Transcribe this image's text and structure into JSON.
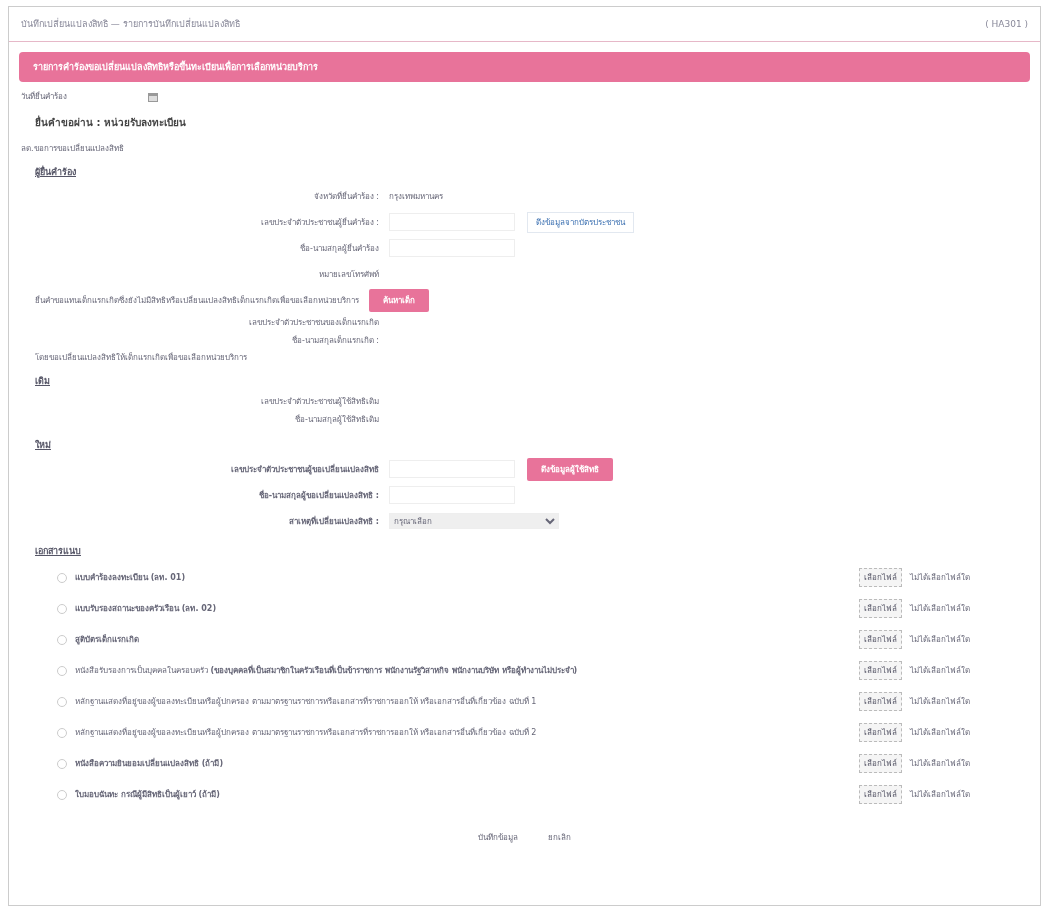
{
  "header": {
    "title": "บันทึกเปลี่ยนแปลงสิทธิ — รายการบันทึกเปลี่ยนแปลงสิทธิ",
    "code": "( HA301 )"
  },
  "banner": "รายการคำร้องขอเปลี่ยนแปลงสิทธิหรือขึ้นทะเบียนเพื่อการเลือกหน่วยบริการ",
  "submit_date": {
    "label": "วันที่ยื่นคำร้อง"
  },
  "channel": "ยื่นคำขอผ่าน : หน่วยรับลงทะเบียน",
  "subtitle": "ลด.ขอการขอเปลี่ยนแปลงสิทธิ",
  "applicant": {
    "heading": "ผู้ยื่นคำร้อง",
    "rows": [
      {
        "kind": "text",
        "label": "จังหวัดที่ยื่นคำร้อง :",
        "value": "กรุงเทพมหานคร"
      },
      {
        "kind": "input",
        "label": "เลขประจำตัวประชาชนผู้ยื่นคำร้อง :",
        "link": "ดึงข้อมูลจากบัตรประชาชน"
      },
      {
        "kind": "input",
        "label": "ชื่อ-นามสกุลผู้ยื่นคำร้อง"
      },
      {
        "kind": "text",
        "label": "หมายเลขโทรศัพท์"
      }
    ],
    "child_search": {
      "label": "ยื่นคำขอแทนเด็กแรกเกิดซึ่งยังไม่มีสิทธิหรือเปลี่ยนแปลงสิทธิเด็กแรกเกิดเพื่อขอเลือกหน่วยบริการ",
      "button": "ค้นหาเด็ก"
    },
    "child_rows": [
      {
        "label": "เลขประจำตัวประชาชนของเด็กแรกเกิด"
      },
      {
        "label": "ชื่อ-นามสกุลเด็กแรกเกิด :"
      }
    ],
    "note": "โดยขอเปลี่ยนแปลงสิทธิให้เด็กแรกเกิดเพื่อขอเลือกหน่วยบริการ"
  },
  "old": {
    "heading": "เดิม",
    "rows": [
      {
        "label": "เลขประจำตัวประชาชนผู้ใช้สิทธิเดิม"
      },
      {
        "label": "ชื่อ-นามสกุลผู้ใช้สิทธิเดิม"
      }
    ]
  },
  "new": {
    "heading": "ใหม่",
    "rows": [
      {
        "kind": "input",
        "label": "เลขประจำตัวประชาชนผู้ขอเปลี่ยนแปลงสิทธิ",
        "button": "ดึงข้อมูลผู้ใช้สิทธิ"
      },
      {
        "kind": "input",
        "label": "ชื่อ-นามสกุลผู้ขอเปลี่ยนแปลงสิทธิ :"
      },
      {
        "kind": "select",
        "label": "สาเหตุที่เปลี่ยนแปลงสิทธิ :",
        "value": "กรุณาเลือก"
      }
    ]
  },
  "attachments": {
    "heading": "เอกสารแนบ",
    "items": [
      {
        "label": "แบบคำร้องลงทะเบียน (ลท. 01)",
        "bold": true,
        "checked": false,
        "choose": "เลือกไฟล์",
        "none": "ไม่ได้เลือกไฟล์ใด"
      },
      {
        "label": "แบบรับรองสถานะของครัวเรือน (ลท. 02)",
        "bold": true,
        "checked": false,
        "choose": "เลือกไฟล์",
        "none": "ไม่ได้เลือกไฟล์ใด"
      },
      {
        "label": "สูติบัตรเด็กแรกเกิด",
        "bold": true,
        "checked": false,
        "choose": "เลือกไฟล์",
        "none": "ไม่ได้เลือกไฟล์ใด"
      },
      {
        "label": "หนังสือรับรองการเป็นบุคคลในครอบครัว **(ของบุคคลที่เป็นสมาชิกในครัวเรือนที่เป็นข้าราชการ พนักงานรัฐวิสาหกิจ พนักงานบริษัท หรือผู้ทำงานไม่ประจำ)**",
        "bold": false,
        "checked": false,
        "choose": "เลือกไฟล์",
        "none": "ไม่ได้เลือกไฟล์ใด"
      },
      {
        "label": "หลักฐานแสดงที่อยู่ของผู้ขอลงทะเบียนหรือผู้ปกครอง ตามมาตรฐานราชการหรือเอกสารที่ราชการออกให้ หรือเอกสารอื่นที่เกี่ยวข้อง ฉบับที่ 1",
        "bold": false,
        "checked": false,
        "choose": "เลือกไฟล์",
        "none": "ไม่ได้เลือกไฟล์ใด"
      },
      {
        "label": "หลักฐานแสดงที่อยู่ของผู้ขอลงทะเบียนหรือผู้ปกครอง ตามมาตรฐานราชการหรือเอกสารที่ราชการออกให้ หรือเอกสารอื่นที่เกี่ยวข้อง ฉบับที่ 2",
        "bold": false,
        "checked": false,
        "choose": "เลือกไฟล์",
        "none": "ไม่ได้เลือกไฟล์ใด"
      },
      {
        "label": "หนังสือความยินยอมเปลี่ยนแปลงสิทธิ (ถ้ามี)",
        "bold": true,
        "checked": false,
        "choose": "เลือกไฟล์",
        "none": "ไม่ได้เลือกไฟล์ใด"
      },
      {
        "label": "ใบมอบฉันทะ กรณีผู้มีสิทธิเป็นผู้เยาว์ (ถ้ามี)",
        "bold": true,
        "checked": false,
        "choose": "เลือกไฟล์",
        "none": "ไม่ได้เลือกไฟล์ใด"
      }
    ]
  },
  "actions": [
    "บันทึกข้อมูล",
    "ยกเลิก"
  ]
}
